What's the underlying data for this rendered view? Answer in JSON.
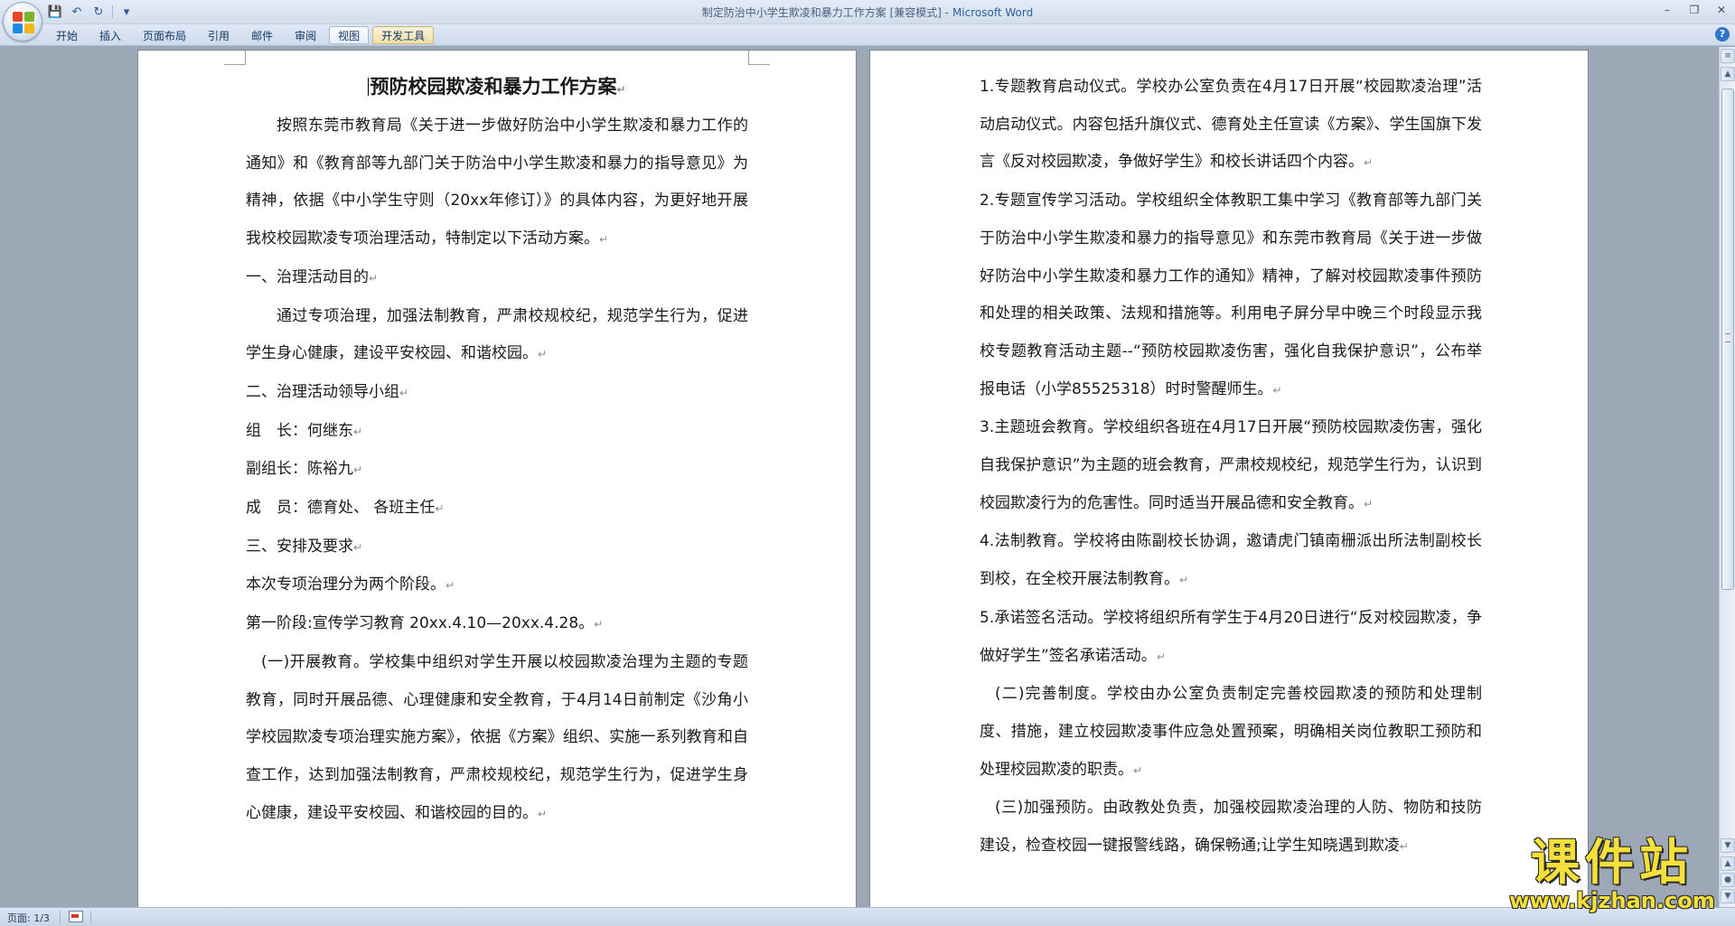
{
  "window": {
    "title_doc": "制定防治中小学生欺凌和暴力工作方案 [兼容模式]",
    "title_sep": " - ",
    "title_app": "Microsoft Word"
  },
  "qat": {
    "save": "💾",
    "undo": "↶",
    "redo": "↻",
    "customize": "▾"
  },
  "tabs": [
    "开始",
    "插入",
    "页面布局",
    "引用",
    "邮件",
    "审阅",
    "视图",
    "开发工具"
  ],
  "left_page": {
    "title": "预防校园欺凌和暴力工作方案",
    "paragraphs": [
      {
        "text": "按照东莞市教育局《关于进一步做好防治中小学生欺凌和暴力工作的通知》和《教育部等九部门关于防治中小学生欺凌和暴力的指导意见》为精神，依据《中小学生守则（20xx年修订）》的具体内容，为更好地开展我校校园欺凌专项治理活动，特制定以下活动方案。",
        "style": "indent"
      },
      {
        "text": "一、治理活动目的",
        "style": ""
      },
      {
        "text": "通过专项治理，加强法制教育，严肃校规校纪，规范学生行为，促进学生身心健康，建设平安校园、和谐校园。",
        "style": "indent"
      },
      {
        "text": "二、治理活动领导小组",
        "style": ""
      },
      {
        "text": "组　长：何继东",
        "style": ""
      },
      {
        "text": "副组长：陈裕九",
        "style": ""
      },
      {
        "text": "成　员：德育处、 各班主任",
        "style": ""
      },
      {
        "text": "三、安排及要求",
        "style": ""
      },
      {
        "text": "本次专项治理分为两个阶段。",
        "style": ""
      },
      {
        "text": "第一阶段:宣传学习教育 20xx.4.10—20xx.4.28。",
        "style": ""
      },
      {
        "text": "(一)开展教育。学校集中组织对学生开展以校园欺凌治理为主题的专题教育，同时开展品德、心理健康和安全教育，于4月14日前制定《沙角小学校园欺凌专项治理实施方案》，依据《方案》组织、实施一系列教育和自查工作，达到加强法制教育，严肃校规校纪，规范学生行为，促进学生身心健康，建设平安校园、和谐校园的目的。",
        "style": "indent1"
      }
    ]
  },
  "right_page": {
    "paragraphs": [
      {
        "text": "1.专题教育启动仪式。学校办公室负责在4月17日开展“校园欺凌治理”活动启动仪式。内容包括升旗仪式、德育处主任宣读《方案》、学生国旗下发言《反对校园欺凌，争做好学生》和校长讲话四个内容。",
        "style": ""
      },
      {
        "text": "2.专题宣传学习活动。学校组织全体教职工集中学习《教育部等九部门关于防治中小学生欺凌和暴力的指导意见》和东莞市教育局《关于进一步做好防治中小学生欺凌和暴力工作的通知》精神，了解对校园欺凌事件预防和处理的相关政策、法规和措施等。利用电子屏分早中晚三个时段显示我校专题教育活动主题--“预防校园欺凌伤害，强化自我保护意识”，公布举报电话（小学85525318）时时警醒师生。",
        "style": ""
      },
      {
        "text": "3.主题班会教育。学校组织各班在4月17日开展“预防校园欺凌伤害，强化自我保护意识”为主题的班会教育，严肃校规校纪，规范学生行为，认识到校园欺凌行为的危害性。同时适当开展品德和安全教育。",
        "style": ""
      },
      {
        "text": "4.法制教育。学校将由陈副校长协调，邀请虎门镇南栅派出所法制副校长到校，在全校开展法制教育。",
        "style": ""
      },
      {
        "text": "5.承诺签名活动。学校将组织所有学生于4月20日进行“反对校园欺凌，争做好学生”签名承诺活动。",
        "style": ""
      },
      {
        "text": "(二)完善制度。学校由办公室负责制定完善校园欺凌的预防和处理制度、措施，建立校园欺凌事件应急处置预案，明确相关岗位教职工预防和处理校园欺凌的职责。",
        "style": "indent1"
      },
      {
        "text": "(三)加强预防。由政教处负责，加强校园欺凌治理的人防、物防和技防建设，检查校园一键报警线路，确保畅通;让学生知晓遇到欺凌",
        "style": "indent1"
      }
    ]
  },
  "paragraph_mark": "↵",
  "status": {
    "page": "页面: 1/3"
  },
  "watermark": {
    "main": "课件站",
    "url": "www.kjzhan.com"
  }
}
